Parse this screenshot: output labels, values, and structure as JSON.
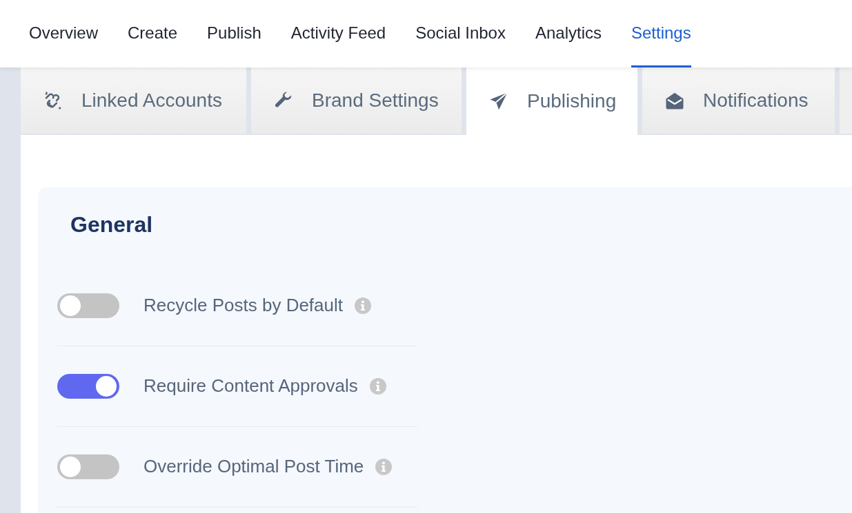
{
  "nav": [
    {
      "label": "Overview",
      "selected": false
    },
    {
      "label": "Create",
      "selected": false
    },
    {
      "label": "Publish",
      "selected": false
    },
    {
      "label": "Activity Feed",
      "selected": false
    },
    {
      "label": "Social Inbox",
      "selected": false
    },
    {
      "label": "Analytics",
      "selected": false
    },
    {
      "label": "Settings",
      "selected": true
    }
  ],
  "tabs": [
    {
      "label": "Linked Accounts",
      "selected": false
    },
    {
      "label": "Brand Settings",
      "selected": false
    },
    {
      "label": "Publishing",
      "selected": true
    },
    {
      "label": "Notifications",
      "selected": false
    }
  ],
  "section": {
    "title": "General",
    "settings": [
      {
        "label": "Recycle Posts by Default",
        "on": false
      },
      {
        "label": "Require Content Approvals",
        "on": true
      },
      {
        "label": "Override Optimal Post Time",
        "on": false
      }
    ]
  }
}
